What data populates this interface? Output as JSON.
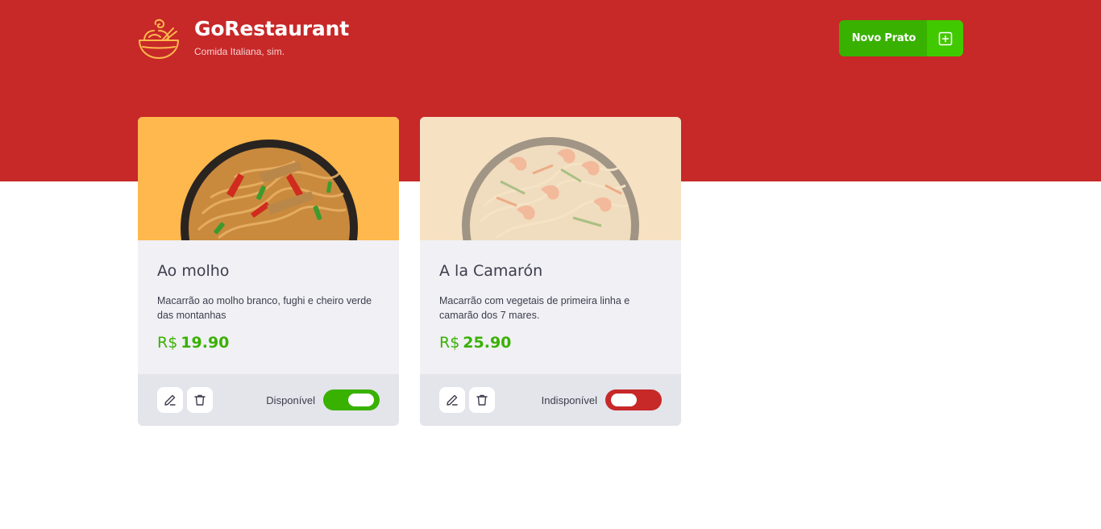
{
  "brand": {
    "title": "GoRestaurant",
    "subtitle": "Comida Italiana, sim.",
    "logo_icon": "noodle-bowl-icon",
    "logo_color": "#ffb84d"
  },
  "header": {
    "new_dish_label": "Novo Prato",
    "new_dish_icon": "plus-square-icon"
  },
  "colors": {
    "header_bg": "#c72828",
    "card_bg": "#f0f0f5",
    "footer_bg": "#e4e4eb",
    "price": "#39b100",
    "toggle_on": "#39b100",
    "toggle_off": "#c72828"
  },
  "dishes": [
    {
      "name": "Ao molho",
      "description": "Macarrão ao molho branco, fughi e cheiro verde das montanhas",
      "currency": "R$",
      "price": "19.90",
      "available": true,
      "availability_label": "Disponível",
      "edit_icon": "pencil-icon",
      "delete_icon": "trash-icon"
    },
    {
      "name": "A la Camarón",
      "description": "Macarrão com vegetais de primeira linha e camarão dos 7 mares.",
      "currency": "R$",
      "price": "25.90",
      "available": false,
      "availability_label": "Indisponível",
      "edit_icon": "pencil-icon",
      "delete_icon": "trash-icon"
    }
  ]
}
